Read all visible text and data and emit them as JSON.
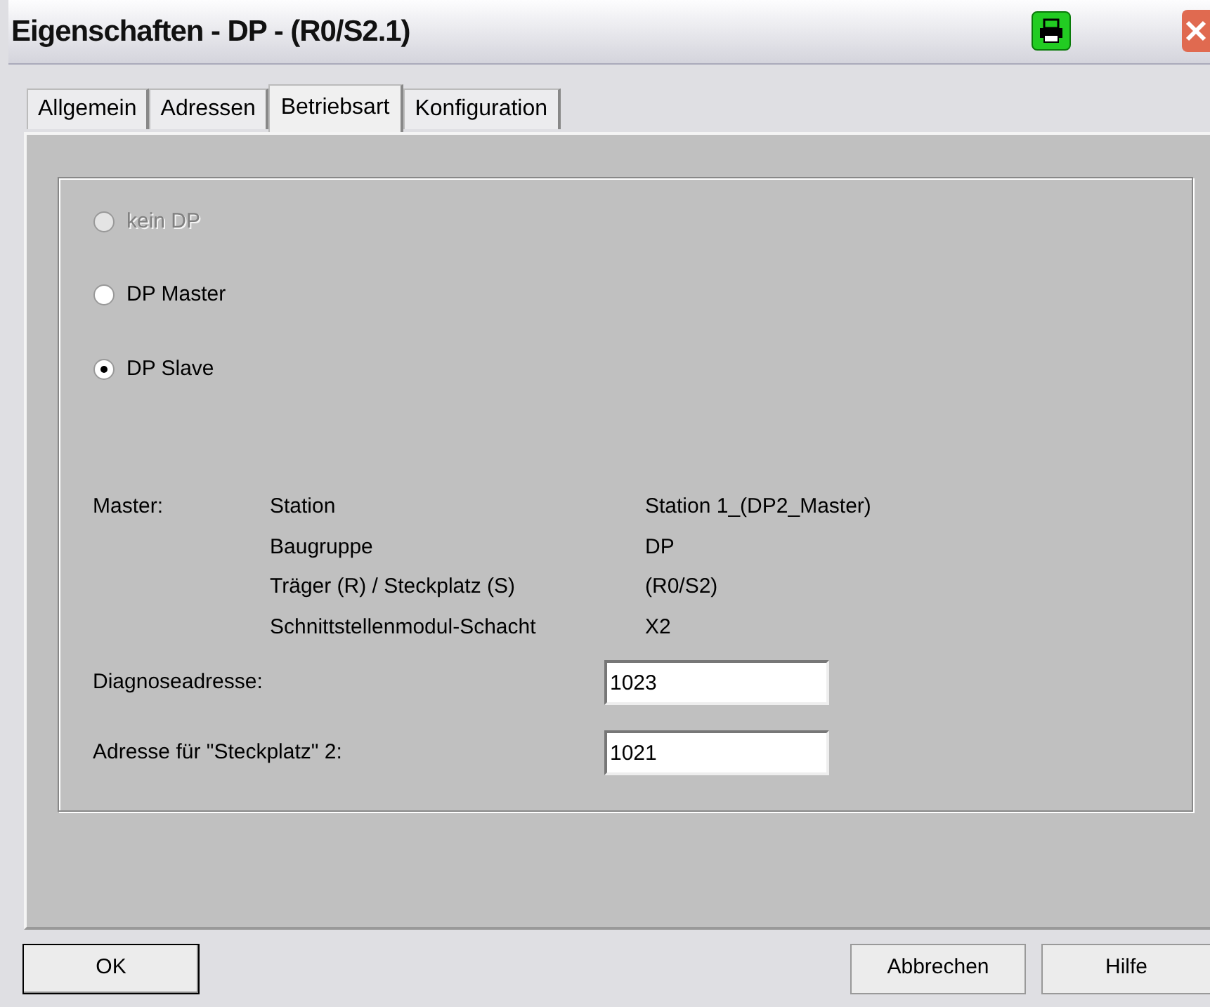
{
  "window": {
    "title": "Eigenschaften - DP - (R0/S2.1)"
  },
  "tabs": [
    {
      "label": "Allgemein",
      "selected": false
    },
    {
      "label": "Adressen",
      "selected": false
    },
    {
      "label": "Betriebsart",
      "selected": true
    },
    {
      "label": "Konfiguration",
      "selected": false
    }
  ],
  "mode_options": [
    {
      "label": "kein DP",
      "selected": false,
      "disabled": true
    },
    {
      "label": "DP Master",
      "selected": false,
      "disabled": false
    },
    {
      "label": "DP Slave",
      "selected": true,
      "disabled": false
    }
  ],
  "master": {
    "label": "Master:",
    "rows": [
      {
        "name": "Station",
        "value": "Station 1_(DP2_Master)"
      },
      {
        "name": "Baugruppe",
        "value": "DP"
      },
      {
        "name": "Träger (R) / Steckplatz (S)",
        "value": "(R0/S2)"
      },
      {
        "name": "Schnittstellenmodul-Schacht",
        "value": "X2"
      }
    ]
  },
  "fields": [
    {
      "label": "Diagnoseadresse:",
      "value": "1023"
    },
    {
      "label": "Adresse für \"Steckplatz\" 2:",
      "value": "1021"
    }
  ],
  "buttons": [
    {
      "label": "OK"
    },
    {
      "label": "Abbrechen"
    },
    {
      "label": "Hilfe"
    }
  ]
}
